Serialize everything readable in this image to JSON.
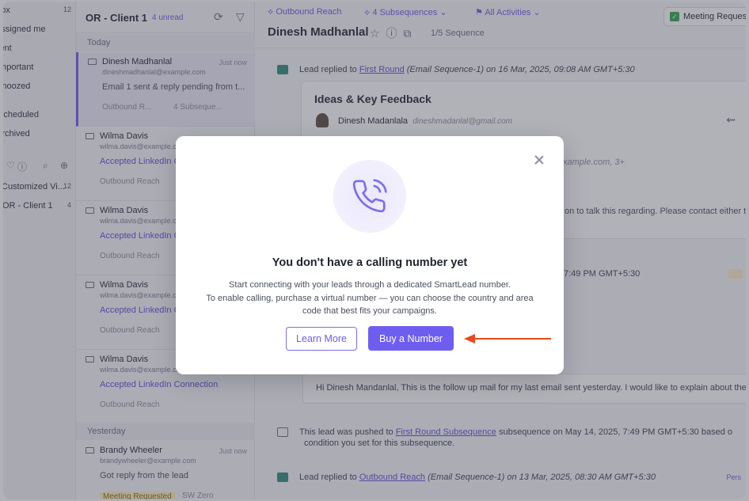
{
  "nav": {
    "items": [
      {
        "label": "Inbox",
        "count": "12"
      },
      {
        "label": "Assigned me",
        "count": ""
      },
      {
        "label": "Sent",
        "count": ""
      },
      {
        "label": "Important",
        "count": ""
      },
      {
        "label": "Snoozed",
        "count": ""
      },
      {
        "label": "Scheduled",
        "count": ""
      },
      {
        "label": "Archived",
        "count": ""
      },
      {
        "label": "Customized Vi...",
        "count": "12"
      },
      {
        "label": "OR - Client 1",
        "count": "4"
      }
    ]
  },
  "list": {
    "title": "OR - Client 1",
    "unread": "4 unread",
    "group_today": "Today",
    "group_yesterday": "Yesterday",
    "leads": [
      {
        "name": "Dinesh Madhanlal",
        "time": "Just now",
        "email": "dineshmadhanlal@example.com",
        "snippet": "Email 1 sent & reply pending from t...",
        "tag1": "Outbound R...",
        "tag2": "4 Subseque..."
      },
      {
        "name": "Wilma Davis",
        "time": "",
        "email": "wilma.davis@example.com",
        "snippet": "Accepted LinkedIn Connection",
        "tag1": "Outbound Reach",
        "tag2": ""
      },
      {
        "name": "Wilma Davis",
        "time": "",
        "email": "wilma.davis@example.com",
        "snippet": "Accepted LinkedIn Connection",
        "tag1": "Outbound Reach",
        "tag2": ""
      },
      {
        "name": "Wilma Davis",
        "time": "",
        "email": "wilma.davis@example.com",
        "snippet": "Accepted LinkedIn Connection",
        "tag1": "Outbound Reach",
        "tag2": ""
      },
      {
        "name": "Wilma Davis",
        "time": "",
        "email": "wilma.davis@example.com",
        "snippet": "Accepted LinkedIn Connection",
        "tag1": "Outbound Reach",
        "tag2": ""
      },
      {
        "name": "Brandy Wheeler",
        "time": "Just now",
        "email": "brandywheeler@example.com",
        "snippet": "Got reply from the lead",
        "tag1": "Meeting Requested",
        "tag2": "SW Zero"
      }
    ]
  },
  "detail": {
    "crumb_campaign": "Outbound Reach",
    "crumb_subseq": "4 Subsequences",
    "crumb_filter": "All Activities",
    "meeting_label": "Meeting Requested",
    "lead_name": "Dinesh Madhanlal",
    "sequence": "1/5 Sequence",
    "activity1_pre": "Lead replied to",
    "activity1_link": "First Round",
    "activity1_post": "(Email Sequence-1) on 16 Mar, 2025, 09:08 AM GMT+5:30",
    "card_title": "Ideas & Key Feedback",
    "card_from": "Dinesh Madanlala",
    "card_from_email": "dineshmadanlal@gmail.com",
    "card_to_fragment": "xample.com, 3+",
    "card_body_fragment": "on to talk this regarding. Please contact either t",
    "activity2_fragment": "7:49 PM GMT+5:30",
    "reply_text": "Hi Dinesh Mandanlal, This is the follow up mail for my last email sent yesterday. I would like to explain about the...",
    "activity3_pre": "This lead was pushed to",
    "activity3_link": "First Round Subsequence",
    "activity3_post": "subsequence on May 14, 2025, 7:49 PM GMT+5:30 based o",
    "activity3_line2": "condition you set for this subsequence.",
    "activity4_pre": "Lead replied to",
    "activity4_link": "Outbound Reach",
    "activity4_post": "(Email Sequence-1) on 13 Mar, 2025, 08:30 AM GMT+5:30",
    "badge_fragment": "Pers"
  },
  "modal": {
    "title": "You don't have a calling number yet",
    "body_line1": "Start connecting with your leads through a dedicated SmartLead number.",
    "body_line2": "To enable calling, purchase a virtual number — you can choose the country and area",
    "body_line3": "code that best fits your campaigns.",
    "learn_more": "Learn More",
    "buy_number": "Buy a Number",
    "icon": "phone-calling-icon"
  },
  "colors": {
    "accent": "#6e5ef0",
    "arrow": "#e8491d",
    "overlay": "rgba(70,70,85,0.42)"
  }
}
